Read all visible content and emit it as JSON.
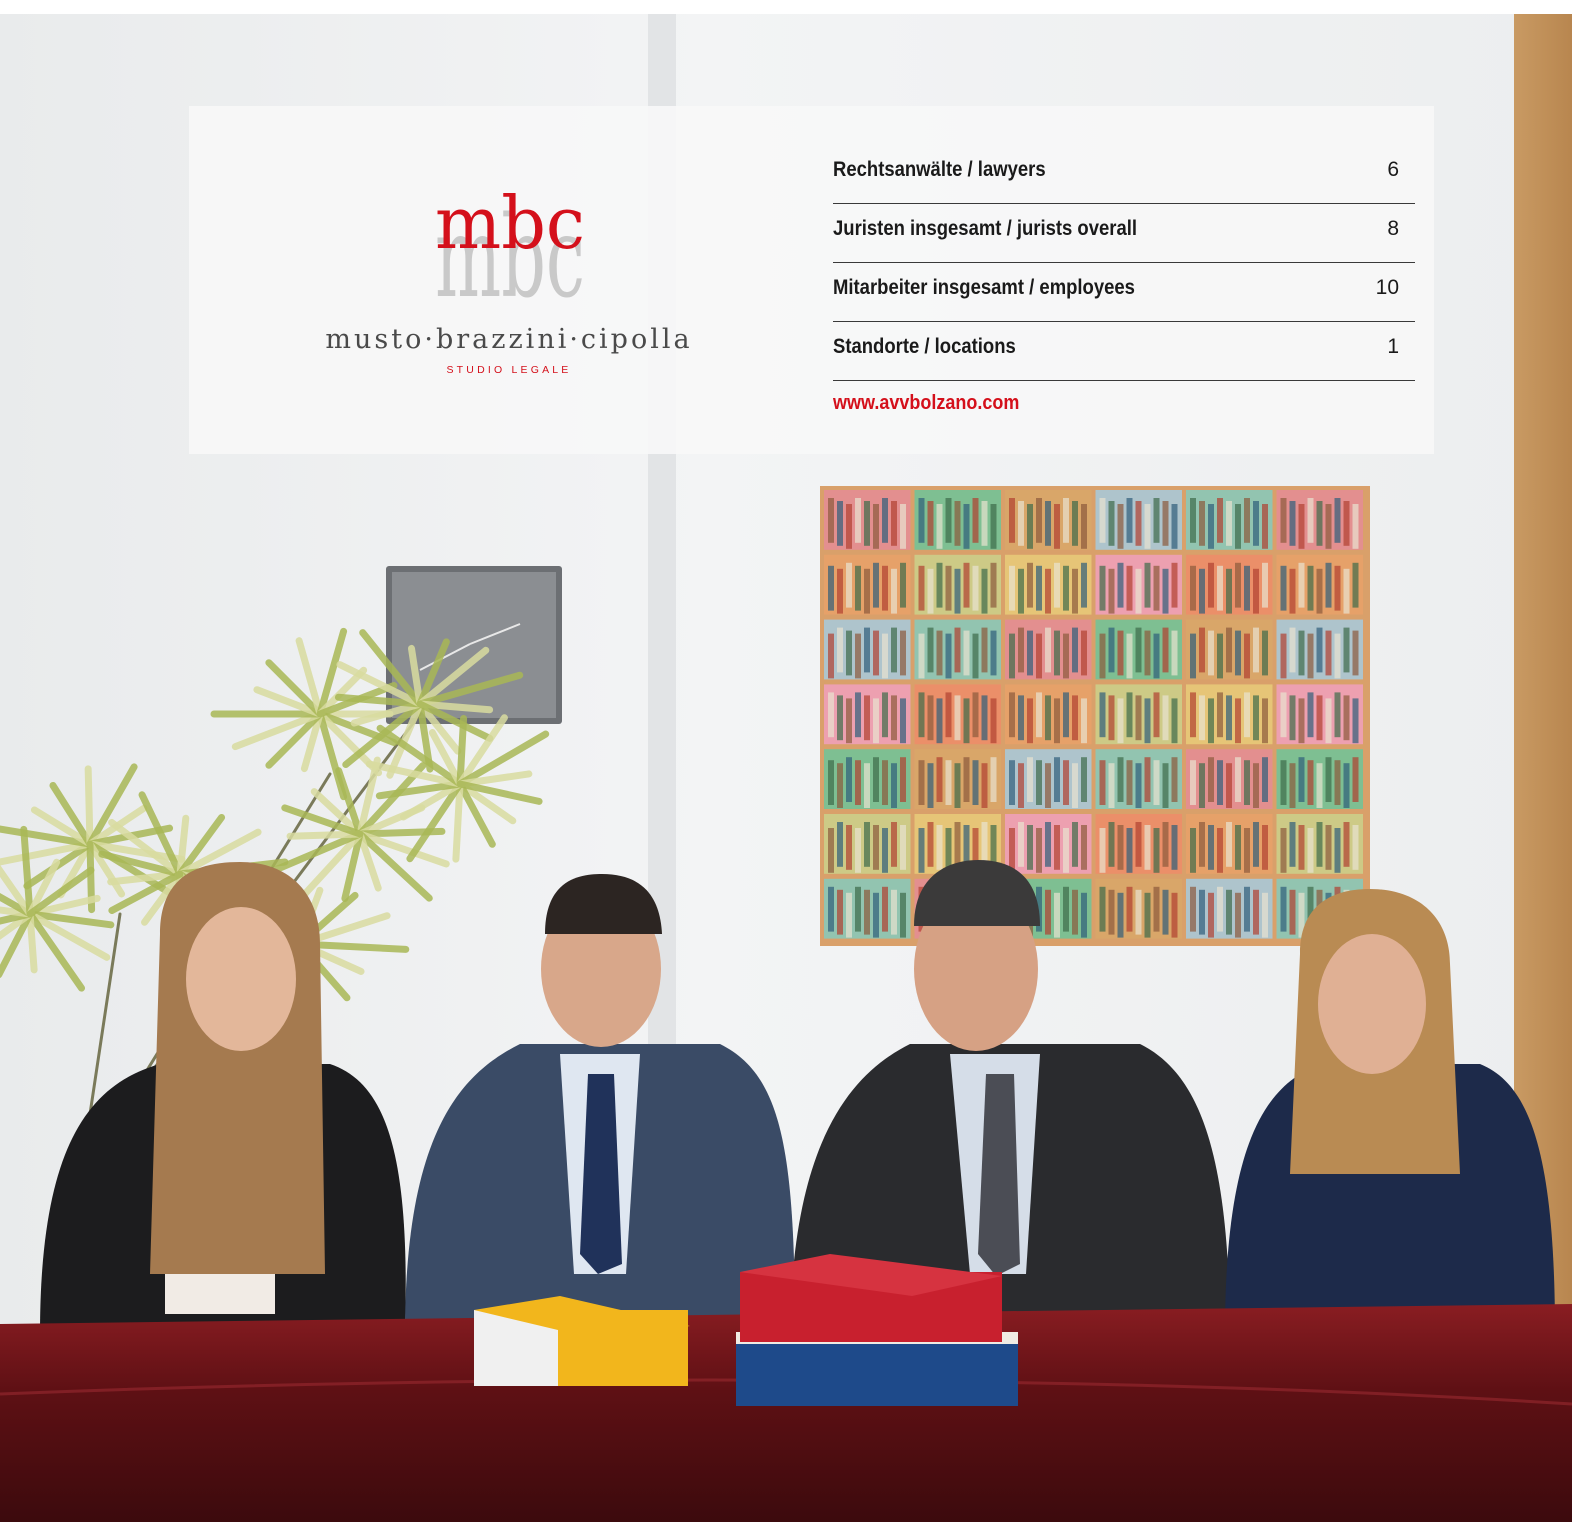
{
  "brand": {
    "logo_letters_top": "mbc",
    "logo_letters_bottom": "mbc",
    "wordmark": "musto·brazzini·cipolla",
    "tagline": "STUDIO LEGALE",
    "accent_color": "#d4101b",
    "logo_gray": "#c9c9c9"
  },
  "stats": [
    {
      "label": "Rechtsanwälte / lawyers",
      "value": "6"
    },
    {
      "label": "Juristen insgesamt / jurists overall",
      "value": "8"
    },
    {
      "label": "Mitarbeiter insgesamt / employees",
      "value": "10"
    },
    {
      "label": "Standorte / locations",
      "value": "1"
    }
  ],
  "website": "www.avvbolzano.com",
  "photo": {
    "scene_icons": [
      "wall-clock-icon",
      "plant-icon",
      "bookshelf-artwork-icon",
      "books-icon"
    ],
    "colors": {
      "wall": "#eef0f1",
      "table": "#6a1418",
      "red_book": "#c8202e",
      "blue_book": "#1e4a8a",
      "yellow_book": "#f2b61c"
    }
  }
}
